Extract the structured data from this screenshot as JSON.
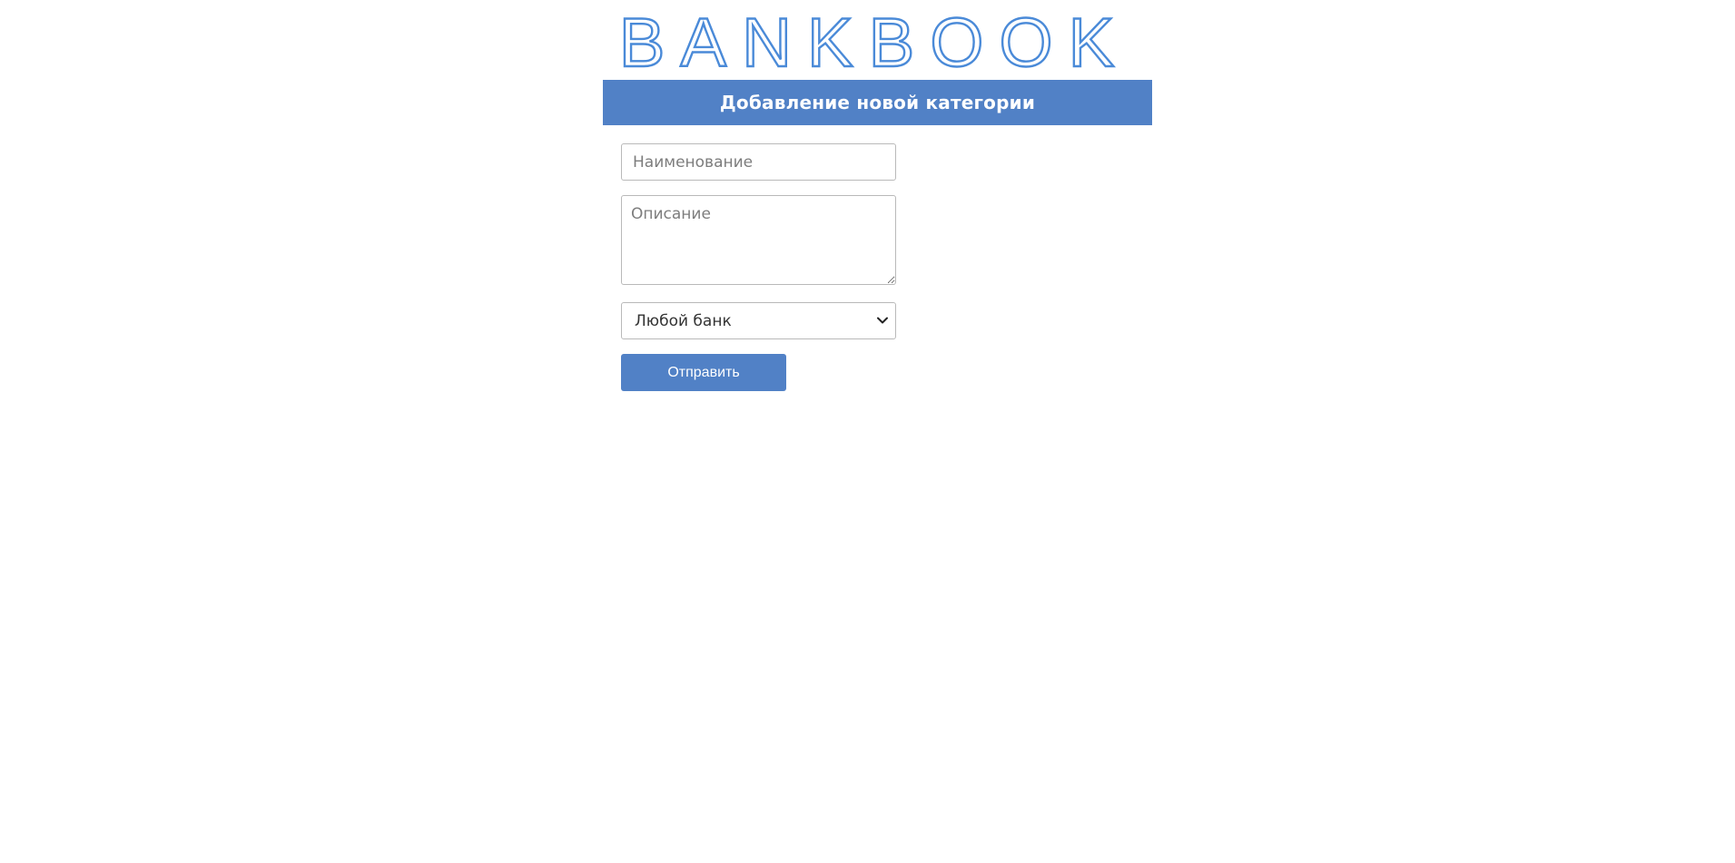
{
  "logo": {
    "text": "BANKBOOK",
    "stroke_color": "#4a8ad8"
  },
  "header": {
    "title": "Добавление новой категории",
    "background_color": "#5181c6"
  },
  "form": {
    "name_input": {
      "placeholder": "Наименование",
      "value": ""
    },
    "description_textarea": {
      "placeholder": "Описание",
      "value": ""
    },
    "bank_select": {
      "selected_value": "Любой банк",
      "arrow_icon": "chevron-down-icon"
    },
    "submit_button": {
      "label": "Отправить",
      "background_color": "#5181c6"
    }
  }
}
